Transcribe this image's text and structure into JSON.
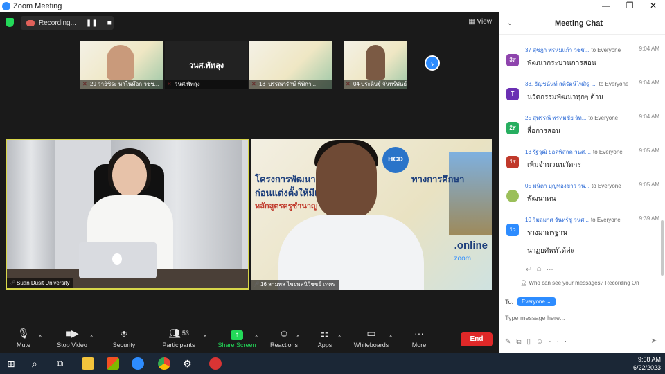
{
  "window": {
    "title": "Zoom Meeting",
    "controls": [
      "—",
      "❐",
      "✕"
    ]
  },
  "topbar": {
    "recording_label": "Recording...",
    "view_label": "View"
  },
  "thumbnails": [
    {
      "name": "29 ว่ายิชิระ หาในท๊อก วชช...",
      "type": "video"
    },
    {
      "name": "วนศ.พัทลุง",
      "type": "avatar",
      "display": "วนศ.พัทลุง"
    },
    {
      "name": "18_บรรณารักษ์ พิพิกา...",
      "type": "video"
    },
    {
      "name": "04 ประดิษฐ์ จันทร์พันธ์_วน...",
      "type": "video"
    }
  ],
  "tiles": [
    {
      "name": "Suan Dusit University"
    },
    {
      "name": "16 สามพล ไชยพลนิวิชชย์ เทศร",
      "slide_title1": "โครงการพัฒนาขี",
      "slide_title_right": "ทางการศึกษา",
      "slide_title2": "ก่อนแต่งตั้งให้มีแล",
      "slide_sub": "หลักสูตรครูชำนาญ",
      "hcd": "HCD",
      "online": ".online",
      "zoom": "zoom"
    }
  ],
  "toolbar": {
    "mute": "Mute",
    "stop_video": "Stop Video",
    "security": "Security",
    "participants": "Participants",
    "participants_count": "53",
    "share_screen": "Share Screen",
    "reactions": "Reactions",
    "apps": "Apps",
    "whiteboards": "Whiteboards",
    "more": "More",
    "end": "End"
  },
  "chat": {
    "title": "Meeting Chat",
    "messages": [
      {
        "avatar": "3ส",
        "color": "#8e44ad",
        "sender": "37 สุชฎา  พรหมแก้ว วชช...",
        "to": "to Everyone",
        "time": "9:04 AM",
        "text": "พัฒนากระบวนการสอน"
      },
      {
        "avatar": "T",
        "color": "#6a2fb3",
        "sender": "33. ธัญชนันท์ สติรัตน์ไพสิฐ_...",
        "to": "to Everyone",
        "time": "9:04 AM",
        "text": "นวัตกรรมพัฒนาทุกๆ ด้าน"
      },
      {
        "avatar": "2ส",
        "color": "#27ae60",
        "sender": "25 สุพรรณี  พรหมชัย วิท...",
        "to": "to Everyone",
        "time": "9:04 AM",
        "text": "สื่อการสอน"
      },
      {
        "avatar": "1ร",
        "color": "#c0392b",
        "sender": "13 รัฐวุฒิ ยอดพิสลค วนศ....",
        "to": "to Everyone",
        "time": "9:05 AM",
        "text": "เพิ่มจำนวนนวัตกร"
      },
      {
        "avatar": "",
        "color": "#9bbf5a",
        "sender": "05 พนิดา บุญทองขาว วน...",
        "to": "to Everyone",
        "time": "9:05 AM",
        "text": "พัฒนาคน"
      },
      {
        "avatar": "1ว",
        "color": "#2d8cff",
        "sender": "10 วิมลมาศ จันทร์ชู วนศ...",
        "to": "to Everyone",
        "time": "9:39 AM",
        "text": "รางมาตรฐาน",
        "text2": "นาฏยศัพท์ได้ค่ะ"
      }
    ],
    "privacy": "Who can see your messages? Recording On",
    "to_label": "To:",
    "recipient": "Everyone ⌄",
    "input_placeholder": "Type message here..."
  },
  "taskbar": {
    "time": "9:58 AM",
    "date": "6/22/2023"
  }
}
